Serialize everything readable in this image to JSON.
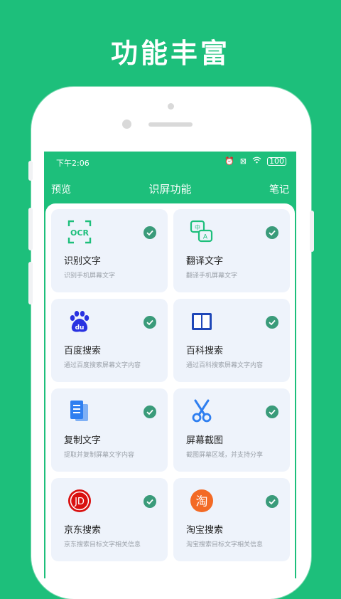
{
  "promo": {
    "title": "功能丰富"
  },
  "status_bar": {
    "time": "下午2:06",
    "battery": "100"
  },
  "header": {
    "left": "预览",
    "title": "识屏功能",
    "right": "笔记"
  },
  "colors": {
    "accent": "#1dbf7b",
    "check": "#3a9b7a",
    "card_bg": "#eef3fb"
  },
  "features": [
    {
      "title": "识别文字",
      "subtitle": "识别手机屏幕文字",
      "icon": "ocr-icon",
      "checked": true
    },
    {
      "title": "翻译文字",
      "subtitle": "翻译手机屏幕文字",
      "icon": "translate-icon",
      "checked": true
    },
    {
      "title": "百度搜索",
      "subtitle": "通过百度搜索屏幕文字内容",
      "icon": "baidu-icon",
      "checked": true
    },
    {
      "title": "百科搜索",
      "subtitle": "通过百科搜索屏幕文字内容",
      "icon": "book-icon",
      "checked": true
    },
    {
      "title": "复制文字",
      "subtitle": "提取并复制屏幕文字内容",
      "icon": "copy-doc-icon",
      "checked": true
    },
    {
      "title": "屏幕截图",
      "subtitle": "截图屏幕区域，并支持分享",
      "icon": "scissors-icon",
      "checked": true
    },
    {
      "title": "京东搜索",
      "subtitle": "京东搜索目标文字相关信息",
      "icon": "jd-icon",
      "icon_text": "JD",
      "checked": true
    },
    {
      "title": "淘宝搜索",
      "subtitle": "淘宝搜索目标文字相关信息",
      "icon": "taobao-icon",
      "icon_text": "淘",
      "checked": true
    }
  ]
}
